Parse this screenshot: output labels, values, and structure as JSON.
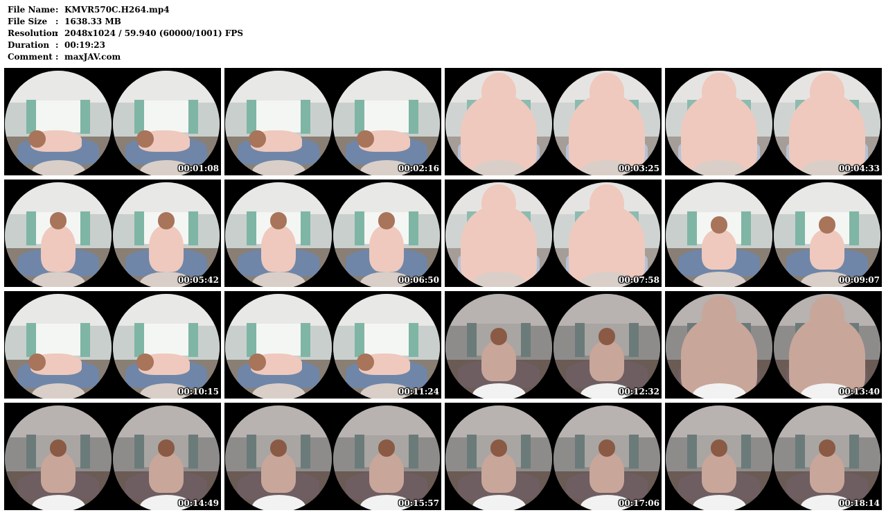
{
  "info": {
    "rows": [
      {
        "label": "File Name",
        "sep": ":",
        "value": "KMVR570C.H264.mp4"
      },
      {
        "label": "File Size",
        "sep": ":",
        "value": "1638.33 MB"
      },
      {
        "label": "Resolution",
        "sep": ":",
        "value": "2048x1024 / 59.940 (60000/1001) FPS"
      },
      {
        "label": "Duration",
        "sep": ":",
        "value": "00:19:23"
      },
      {
        "label": "Comment",
        "sep": ":",
        "value": "maxJAV.com"
      }
    ]
  },
  "thumbnails": [
    {
      "time": "00:01:08",
      "scene": "bright",
      "pose": "lying"
    },
    {
      "time": "00:02:16",
      "scene": "bright",
      "pose": "lying"
    },
    {
      "time": "00:03:25",
      "scene": "close",
      "pose": "close"
    },
    {
      "time": "00:04:33",
      "scene": "close",
      "pose": "close"
    },
    {
      "time": "00:05:42",
      "scene": "bright",
      "pose": "back"
    },
    {
      "time": "00:06:50",
      "scene": "bright",
      "pose": "back"
    },
    {
      "time": "00:07:58",
      "scene": "close",
      "pose": "close"
    },
    {
      "time": "00:09:07",
      "scene": "bright",
      "pose": "sitting"
    },
    {
      "time": "00:10:15",
      "scene": "bright",
      "pose": "lying"
    },
    {
      "time": "00:11:24",
      "scene": "bright",
      "pose": "lying"
    },
    {
      "time": "00:12:32",
      "scene": "dim",
      "pose": "sitting"
    },
    {
      "time": "00:13:40",
      "scene": "dim",
      "pose": "close"
    },
    {
      "time": "00:14:49",
      "scene": "dim",
      "pose": "sitting"
    },
    {
      "time": "00:15:57",
      "scene": "dim",
      "pose": "sitting"
    },
    {
      "time": "00:17:06",
      "scene": "dim",
      "pose": "sitting"
    },
    {
      "time": "00:18:14",
      "scene": "dim",
      "pose": "sitting"
    }
  ],
  "colors": {
    "bright": {
      "ceiling": "#e8e8e6",
      "wall": "#c9cfcd",
      "window": "#f4f6f4",
      "curtain": "#7fb5a4",
      "floor": "#8a7f74",
      "bed": "#6f86a8"
    },
    "close": {
      "ceiling": "#e6e4e2",
      "wall": "#cfd4d2",
      "window": "#f2f2f0",
      "curtain": "#8cbbb0",
      "floor": "#a59d98",
      "bed": "#b7c1d5"
    },
    "dim": {
      "ceiling": "#b8b2b0",
      "wall": "#8e8c8b",
      "window": "#a9a5a2",
      "curtain": "#6b7b7a",
      "floor": "#6b5b55",
      "bed": "#6e5e62"
    }
  }
}
